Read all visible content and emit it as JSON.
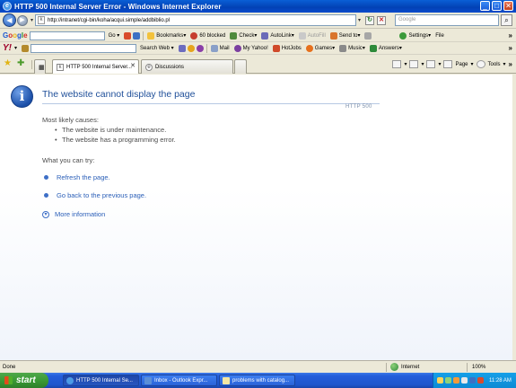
{
  "window": {
    "title": "HTTP 500 Internal Server Error - Windows Internet Explorer"
  },
  "address_bar": {
    "url": "http://intranet/cgi-bin/koha/acqui.simple/addbiblio.pl",
    "search_placeholder": "Google"
  },
  "google_toolbar": {
    "logo": "Google",
    "go_label": "Go",
    "bookmarks_label": "Bookmarks",
    "blocked_label": "60 blocked",
    "check_label": "Check",
    "autolink_label": "AutoLink",
    "autofill_label": "AutoFill",
    "sendto_label": "Send to",
    "settings_label": "Settings",
    "file_label": "File"
  },
  "yahoo_toolbar": {
    "logo": "Y!",
    "search_web_label": "Search Web",
    "mail_label": "Mail",
    "my_yahoo_label": "My Yahoo!",
    "hotjobs_label": "HotJobs",
    "games_label": "Games",
    "music_label": "Music",
    "answers_label": "Answers"
  },
  "tabs": [
    {
      "label": "HTTP 500 Internal Server..."
    },
    {
      "label": "Discussions"
    }
  ],
  "command_bar": {
    "page_label": "Page",
    "tools_label": "Tools"
  },
  "error_page": {
    "title": "The website cannot display the page",
    "http_code": "HTTP 500",
    "causes_heading": "Most likely causes:",
    "causes": [
      "The website is under maintenance.",
      "The website has a programming error."
    ],
    "try_heading": "What you can try:",
    "refresh_link": "Refresh the page.",
    "back_link": "Go back to the previous page.",
    "more_info_link": "More information"
  },
  "status_bar": {
    "status_text": "Done",
    "zone_label": "Internet",
    "zoom_label": "100%"
  },
  "taskbar": {
    "start_label": "start",
    "tasks": [
      {
        "label": "HTTP 500 Internal Se..."
      },
      {
        "label": "Inbox - Outlook Expr..."
      },
      {
        "label": "problems with catalog..."
      }
    ],
    "clock": "11:28 AM"
  },
  "colors": {
    "title_blue": "#1f4f99",
    "link_blue": "#2b5fb8",
    "xp_titlebar": "#0241b5",
    "start_green": "#3a9a35"
  }
}
